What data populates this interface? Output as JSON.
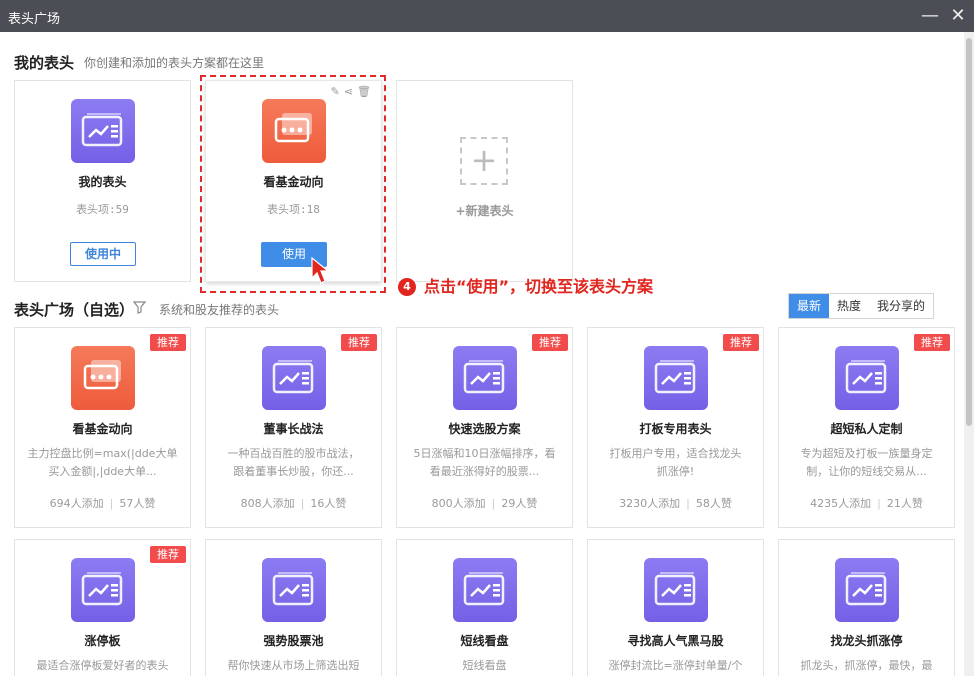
{
  "window": {
    "title": "表头广场"
  },
  "my_section": {
    "title": "我的表头",
    "subtitle": "你创建和添加的表头方案都在这里",
    "cards": [
      {
        "name": "我的表头",
        "count": "表头项:59",
        "button": "使用中",
        "icon": "chart-list-icon",
        "color": "purple"
      },
      {
        "name": "看基金动向",
        "count": "表头项:18",
        "button": "使用",
        "icon": "chat-bubbles-icon",
        "color": "orange"
      }
    ],
    "new_card_label": "+新建表头"
  },
  "annotation": {
    "step": "4",
    "text": "点击“使用”，切换至该表头方案"
  },
  "plaza": {
    "title": "表头广场（自选）",
    "subtitle": "系统和股友推荐的表头",
    "tabs": [
      "最新",
      "热度",
      "我分享的"
    ],
    "active_tab": "最新",
    "tag_label": "推荐",
    "cards": [
      {
        "name": "看基金动向",
        "desc1": "主力控盘比例=max(|dde大单",
        "desc2": "买入金额|,|dde大单...",
        "adds": "694人添加",
        "likes": "57人赞",
        "color": "orange",
        "recommended": true
      },
      {
        "name": "董事长战法",
        "desc1": "一种百战百胜的股市战法，",
        "desc2": "跟着董事长炒股，你还...",
        "adds": "808人添加",
        "likes": "16人赞",
        "color": "purple",
        "recommended": true
      },
      {
        "name": "快速选股方案",
        "desc1": "5日涨幅和10日涨幅排序，看",
        "desc2": "看最近涨得好的股票...",
        "adds": "800人添加",
        "likes": "29人赞",
        "color": "purple",
        "recommended": true
      },
      {
        "name": "打板专用表头",
        "desc1": "打板用户专用，适合找龙头",
        "desc2": "抓涨停!",
        "adds": "3230人添加",
        "likes": "58人赞",
        "color": "purple",
        "recommended": true
      },
      {
        "name": "超短私人定制",
        "desc1": "专为超短及打板一族量身定",
        "desc2": "制，让你的短线交易从...",
        "adds": "4235人添加",
        "likes": "21人赞",
        "color": "purple",
        "recommended": true
      },
      {
        "name": "涨停板",
        "desc1": "最适合涨停板爱好者的表头",
        "desc2": "",
        "adds": "",
        "likes": "",
        "color": "purple",
        "recommended": true
      },
      {
        "name": "强势股票池",
        "desc1": "帮你快速从市场上筛选出短",
        "desc2": "",
        "adds": "",
        "likes": "",
        "color": "purple",
        "recommended": false
      },
      {
        "name": "短线看盘",
        "desc1": "短线看盘",
        "desc2": "",
        "adds": "",
        "likes": "",
        "color": "purple",
        "recommended": false
      },
      {
        "name": "寻找高人气黑马股",
        "desc1": "涨停封流比=涨停封单量/个",
        "desc2": "",
        "adds": "",
        "likes": "",
        "color": "purple",
        "recommended": false
      },
      {
        "name": "找龙头抓涨停",
        "desc1": "抓龙头，抓涨停，最快，最",
        "desc2": "",
        "adds": "",
        "likes": "",
        "color": "purple",
        "recommended": false
      }
    ]
  }
}
